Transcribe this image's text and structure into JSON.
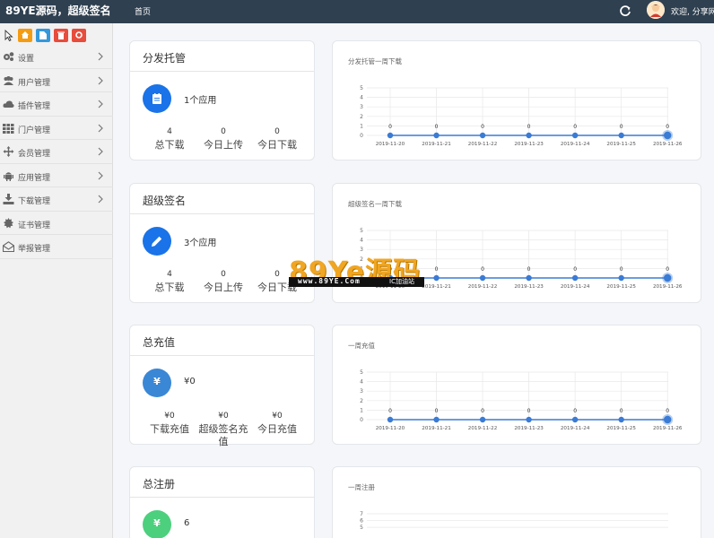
{
  "topbar": {
    "brand": "89YE源码，超级签名",
    "home": "首页",
    "welcome": "欢迎, 分享网"
  },
  "sidebar": {
    "items": [
      {
        "label": "设置",
        "icon": "gears-icon",
        "chevron": true
      },
      {
        "label": "用户管理",
        "icon": "users-icon",
        "chevron": true
      },
      {
        "label": "插件管理",
        "icon": "cloud-icon",
        "chevron": true
      },
      {
        "label": "门户管理",
        "icon": "grid-icon",
        "chevron": true
      },
      {
        "label": "会员管理",
        "icon": "move-icon",
        "chevron": true
      },
      {
        "label": "应用管理",
        "icon": "android-icon",
        "chevron": true
      },
      {
        "label": "下载管理",
        "icon": "download-icon",
        "chevron": true
      },
      {
        "label": "证书管理",
        "icon": "certificate-icon",
        "chevron": false
      },
      {
        "label": "举报管理",
        "icon": "envelope-icon",
        "chevron": false
      }
    ]
  },
  "stats": [
    {
      "title": "分发托管",
      "main": "1个应用",
      "icon": "box-icon",
      "color": "#1a73e8",
      "cols": [
        {
          "value": "4",
          "label": "总下载"
        },
        {
          "value": "0",
          "label": "今日上传"
        },
        {
          "value": "0",
          "label": "今日下载"
        }
      ]
    },
    {
      "title": "超级签名",
      "main": "3个应用",
      "icon": "pencil-icon",
      "color": "#1a73e8",
      "cols": [
        {
          "value": "4",
          "label": "总下载"
        },
        {
          "value": "0",
          "label": "今日上传"
        },
        {
          "value": "0",
          "label": "今日下载"
        }
      ]
    },
    {
      "title": "总充值",
      "main": "¥0",
      "icon": "yen-icon",
      "color": "#3a87d6",
      "cols": [
        {
          "value": "¥0",
          "label": "下载充值"
        },
        {
          "value": "¥0",
          "label": "超级签名充值"
        },
        {
          "value": "¥0",
          "label": "今日充值"
        }
      ]
    },
    {
      "title": "总注册",
      "main": "6",
      "icon": "yen-icon",
      "color": "#4cd07d",
      "cols": []
    }
  ],
  "charts": [
    {
      "title": "分发托管一周下载"
    },
    {
      "title": "超级签名一周下载"
    },
    {
      "title": "一周充值"
    },
    {
      "title": "一周注册"
    }
  ],
  "chart_data": [
    {
      "type": "line",
      "title": "分发托管一周下载",
      "x": [
        "2019-11-20",
        "2019-11-21",
        "2019-11-22",
        "2019-11-23",
        "2019-11-24",
        "2019-11-25",
        "2019-11-26"
      ],
      "values": [
        0,
        0,
        0,
        0,
        0,
        0,
        0
      ],
      "ylim": [
        0,
        5
      ],
      "yticks": [
        0,
        1,
        2,
        3,
        4,
        5
      ]
    },
    {
      "type": "line",
      "title": "超级签名一周下载",
      "x": [
        "2019-11-20",
        "2019-11-21",
        "2019-11-22",
        "2019-11-23",
        "2019-11-24",
        "2019-11-25",
        "2019-11-26"
      ],
      "values": [
        0,
        0,
        0,
        0,
        0,
        0,
        0
      ],
      "ylim": [
        0,
        5
      ],
      "yticks": [
        0,
        1,
        2,
        3,
        4,
        5
      ]
    },
    {
      "type": "line",
      "title": "一周充值",
      "x": [
        "2019-11-20",
        "2019-11-21",
        "2019-11-22",
        "2019-11-23",
        "2019-11-24",
        "2019-11-25",
        "2019-11-26"
      ],
      "values": [
        0,
        0,
        0,
        0,
        0,
        0,
        0
      ],
      "ylim": [
        0,
        5
      ],
      "yticks": [
        0,
        1,
        2,
        3,
        4,
        5
      ]
    },
    {
      "type": "line",
      "title": "一周注册",
      "x": [],
      "values": [],
      "ylim": [
        0,
        7
      ],
      "yticks": [
        5,
        6,
        7
      ]
    }
  ],
  "watermark": {
    "logo": "89Ye源码",
    "url": "www.89YE.Com",
    "tag": "IC加油站"
  }
}
